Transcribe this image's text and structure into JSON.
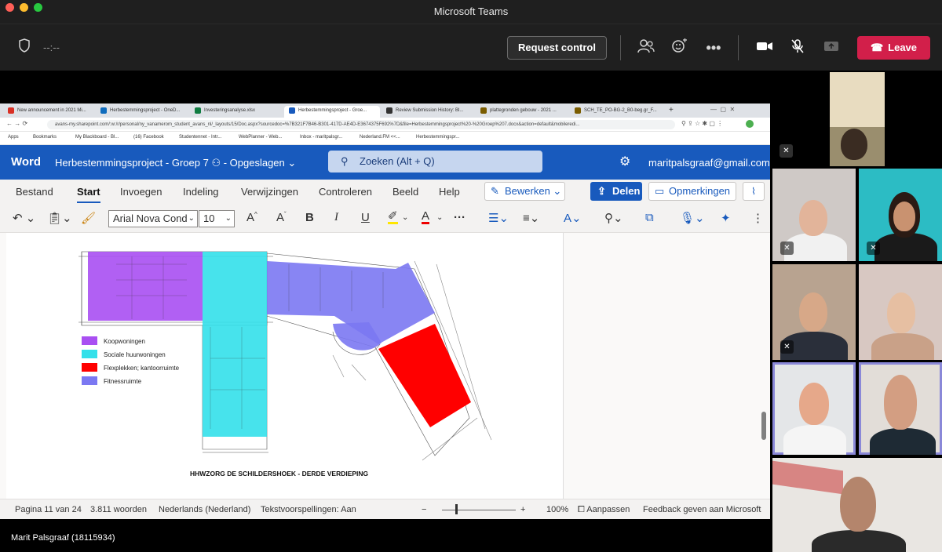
{
  "window": {
    "title": "Microsoft Teams"
  },
  "toolbar": {
    "timer": "--:--",
    "request_control": "Request control",
    "leave": "Leave",
    "icons": [
      "shield-icon",
      "participants-icon",
      "reactions-icon",
      "more-icon",
      "camera-icon",
      "mic-off-icon",
      "share-icon"
    ]
  },
  "browser": {
    "tabs": [
      {
        "label": "New announcement in 2021 Mi...",
        "color": "#d93025"
      },
      {
        "label": "Herbestemmingsproject - OneD...",
        "color": "#0f6cbd"
      },
      {
        "label": "Investeringsanalyse.xlsx",
        "color": "#107c41"
      },
      {
        "label": "Herbestemmingsproject - Groe...",
        "color": "#185abd"
      },
      {
        "label": "Review Submission History: Bl...",
        "color": "#333333"
      },
      {
        "label": "plattegronden gebouw - 2021 ...",
        "color": "#7a5c00"
      },
      {
        "label": "SCH_TE_PO-BG-2_B0-beg.gr_F...",
        "color": "#7a5c00"
      }
    ],
    "url": "avans-my.sharepoint.com/:w:/r/personal/ny_vanamerom_student_avans_nl/_layouts/15/Doc.aspx?sourcedoc=%7B321F7B46-B301-417D-AE4D-E3674375F692%7D&file=Herbestemmingsproject%20-%20Groep%207.docx&action=default&mobileredi...",
    "bookmarks": [
      "Apps",
      "Bookmarks",
      "My Blackboard - Bl...",
      "(16) Facebook",
      "Studentennet - Intr...",
      "WebPlanner - Web...",
      "Inbox - maritpalsgr...",
      "Nederland.FM <<...",
      "Herbestemmingspr..."
    ]
  },
  "word": {
    "brand": "Word",
    "doc_title": "Herbestemmingsproject - Groep 7",
    "save_state": "- Opgeslagen",
    "search": "Zoeken (Alt + Q)",
    "account": "maritpalsgraaf@gmail.com",
    "tabs": [
      "Bestand",
      "Start",
      "Invoegen",
      "Indeling",
      "Verwijzingen",
      "Controleren",
      "Beeld",
      "Help"
    ],
    "active_tab": "Start",
    "edit": "Bewerken",
    "share": "Delen",
    "comments": "Opmerkingen",
    "font": "Arial Nova Cond",
    "size": "10"
  },
  "floorplan": {
    "caption": "HHWZORG DE SCHILDERSHOEK - DERDE VERDIEPING",
    "legend": [
      {
        "label": "Koopwoningen",
        "color": "#a94ff2"
      },
      {
        "label": "Sociale huurwoningen",
        "color": "#33e0ea"
      },
      {
        "label": "Flexplekken; kantoorruimte",
        "color": "#ff0000"
      },
      {
        "label": "Fitnessruimte",
        "color": "#7b78f2"
      }
    ]
  },
  "statusbar": {
    "page": "Pagina 11 van 24",
    "words": "3.811 woorden",
    "language": "Nederlands (Nederland)",
    "predictions": "Tekstvoorspellingen: Aan",
    "zoom": "100%",
    "fit": "Aanpassen",
    "feedback": "Feedback geven aan Microsoft"
  },
  "presenter": {
    "name": "Marit Palsgraaf (18115934)"
  }
}
